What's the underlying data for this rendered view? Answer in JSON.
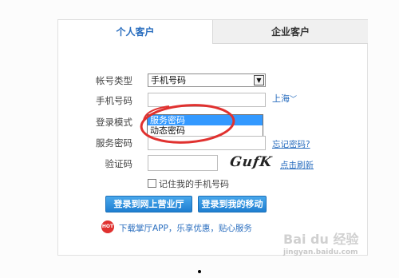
{
  "tabs": [
    {
      "label": "个人客户"
    },
    {
      "label": "企业客户"
    }
  ],
  "form": {
    "account_type_label": "帐号类型",
    "account_type_value": "手机号码",
    "phone_label": "手机号码",
    "phone_value": "",
    "region_link": "上海",
    "login_mode_label": "登录模式",
    "login_mode_options": [
      "服务密码",
      "动态密码"
    ],
    "password_label": "服务密码",
    "forgot_password_link": "忘记密码?",
    "captcha_label": "验证码",
    "captcha_text": "GufK",
    "refresh_link": "点击刷新",
    "remember_label": "记住我的手机号码",
    "remember_checked": false
  },
  "buttons": {
    "login": "登录到网上营业厅",
    "mobile": "登录到我的移动"
  },
  "app_promo": {
    "icon_text": "HOT",
    "text": "下载掌厅APP，乐享优惠，贴心服务"
  },
  "watermark": {
    "title": "Bai du 经验",
    "subtitle": "jingyan.baidu.com"
  },
  "colors": {
    "accent": "#2a6ebf",
    "button": "#2a8fe0",
    "selection": "#3399ff",
    "annotation": "#e0312f"
  }
}
